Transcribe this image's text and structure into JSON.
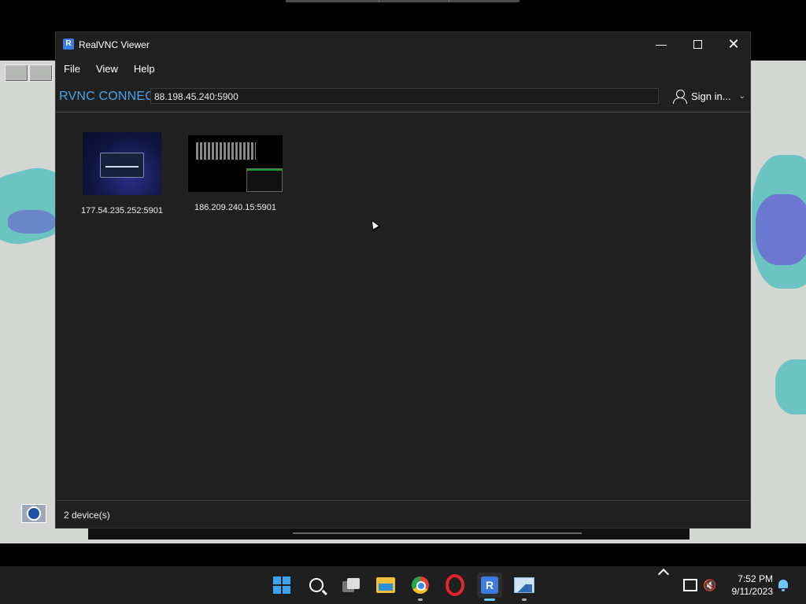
{
  "window": {
    "title": "RealVNC Viewer",
    "app_icon_glyph": "R"
  },
  "menu": [
    "File",
    "View",
    "Help"
  ],
  "toolbar": {
    "logo": "RVNC CONNECT",
    "address_value": "88.198.45.240:5900",
    "sign_in": "Sign in..."
  },
  "devices": [
    {
      "label": "177.54.235.252:5901"
    },
    {
      "label": "186.209.240.15:5901"
    }
  ],
  "status": {
    "text": "2 device(s)"
  },
  "taskbar": {
    "icons": [
      "start-icon",
      "search-icon",
      "task-view-icon",
      "file-explorer-icon",
      "chrome-icon",
      "opera-icon",
      "realvnc-icon",
      "photos-icon"
    ],
    "time": "7:52 PM",
    "date": "9/11/2023"
  },
  "colors": {
    "window_bg": "#202020",
    "logo_blue": "#4aa3ea",
    "taskbar_bg": "#1f1f1f",
    "accent": "#6cc6ff"
  }
}
